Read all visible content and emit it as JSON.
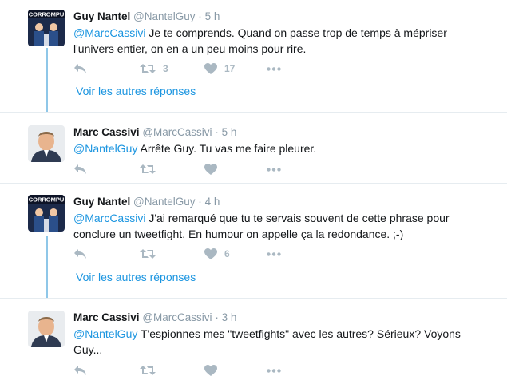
{
  "tweets": [
    {
      "name": "Guy Nantel",
      "handle": "@NantelGuy",
      "time": "5 h",
      "mention": "@MarcCassivi",
      "text": " Je te comprends. Quand on passe trop de temps à mépriser l'univers entier, on en a un peu moins pour rire.",
      "retweets": "3",
      "likes": "17",
      "more_replies": "Voir les autres réponses",
      "avatar_text": "CORROMPU"
    },
    {
      "name": "Marc Cassivi",
      "handle": "@MarcCassivi",
      "time": "5 h",
      "mention": "@NantelGuy",
      "text": " Arrête Guy. Tu vas me faire pleurer.",
      "retweets": "",
      "likes": ""
    },
    {
      "name": "Guy Nantel",
      "handle": "@NantelGuy",
      "time": "4 h",
      "mention": "@MarcCassivi",
      "text": " J'ai remarqué que tu te servais souvent de cette phrase pour conclure un tweetfight. En humour on appelle ça la redondance. ;-)",
      "retweets": "",
      "likes": "6",
      "more_replies": "Voir les autres réponses",
      "avatar_text": "CORROMPU"
    },
    {
      "name": "Marc Cassivi",
      "handle": "@MarcCassivi",
      "time": "3 h",
      "mention": "@NantelGuy",
      "text": " T'espionnes mes \"tweetfights\" avec les autres? Sérieux? Voyons Guy...",
      "retweets": "",
      "likes": ""
    }
  ],
  "separator": "·",
  "colors": {
    "link": "#1b95e0",
    "muted": "#8899a6",
    "icon": "#aab8c2",
    "connector": "#8fc7e8"
  },
  "icons": [
    "reply-icon",
    "retweet-icon",
    "like-icon",
    "more-icon"
  ]
}
